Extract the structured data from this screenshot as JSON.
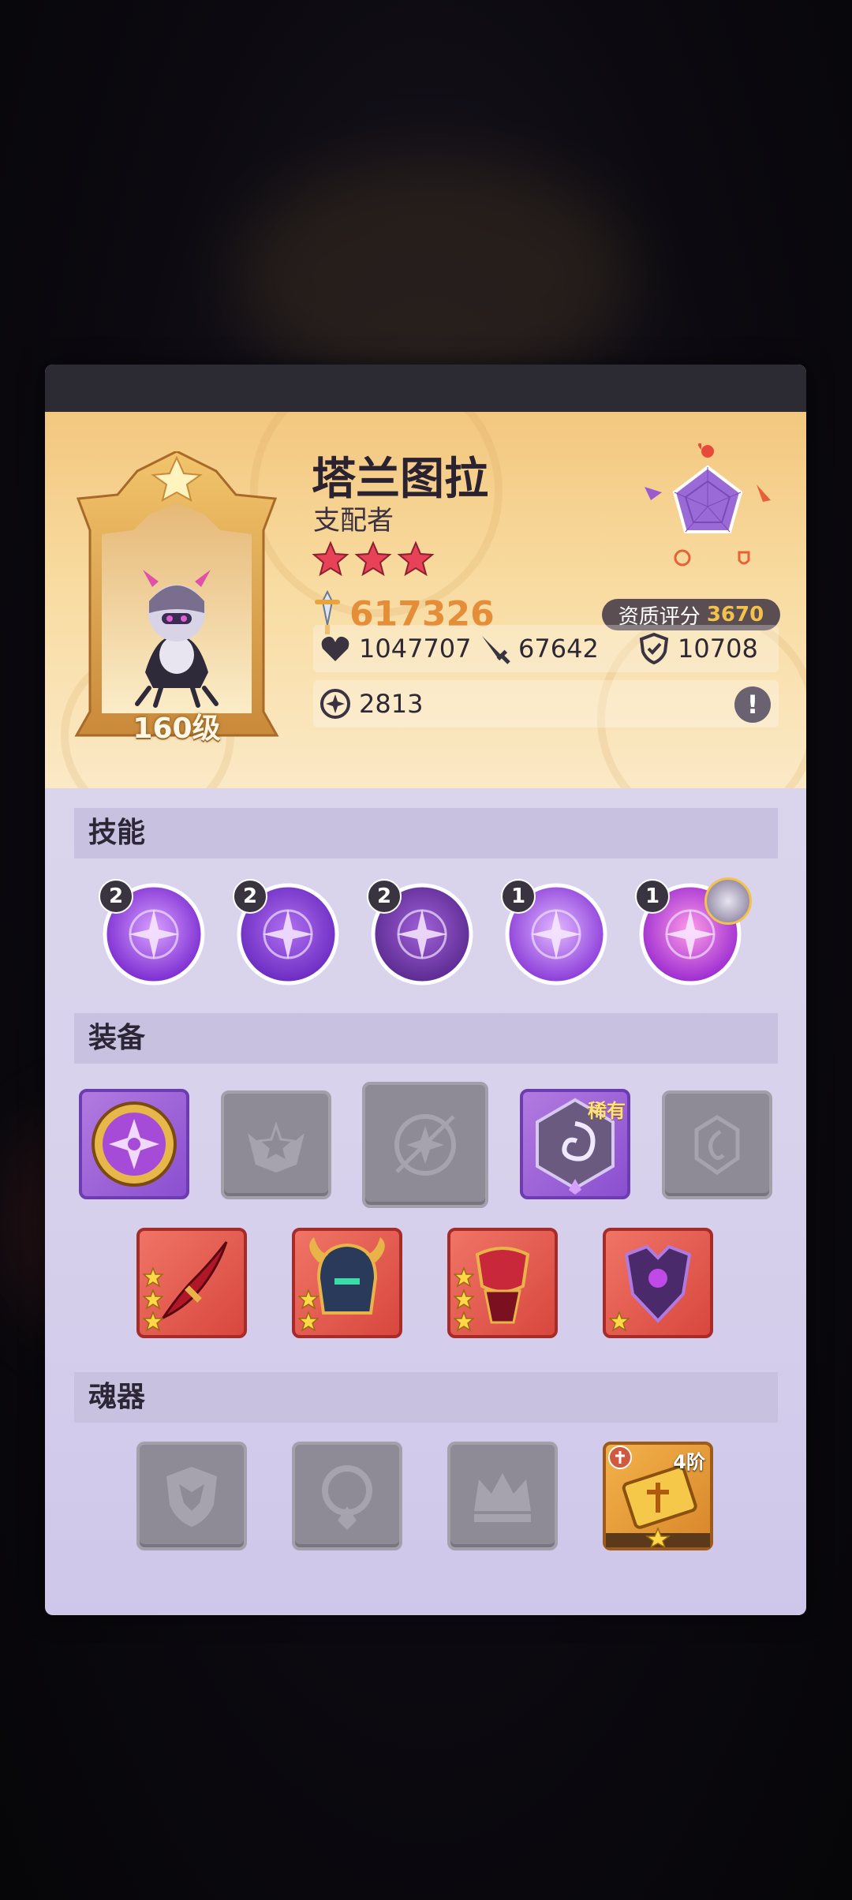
{
  "hero": {
    "name": "塔兰图拉",
    "role": "支配者",
    "level_label": "160级",
    "star_count": 3,
    "power": "617326",
    "quality_label": "资质评分",
    "quality_value": "3670",
    "stats": {
      "hp": "1047707",
      "attack": "67642",
      "defense": "10708",
      "speed": "2813"
    },
    "info_icon": "exclamation-icon"
  },
  "sections": {
    "skills": "技能",
    "equipment": "装备",
    "soul_artifacts": "魂器"
  },
  "skills": [
    {
      "level": "2",
      "icon": "claw-slash-icon"
    },
    {
      "level": "2",
      "icon": "web-drop-icon"
    },
    {
      "level": "2",
      "icon": "shadow-demon-icon"
    },
    {
      "level": "1",
      "icon": "spider-web-icon"
    },
    {
      "level": "1",
      "icon": "star-burst-icon"
    }
  ],
  "equipment": {
    "rare_label": "稀有",
    "rune_slots": [
      {
        "state": "filled",
        "icon": "compass-rune-icon"
      },
      {
        "state": "empty",
        "icon": "wing-star-icon"
      },
      {
        "state": "empty",
        "icon": "orbit-star-icon"
      },
      {
        "state": "filled-rare",
        "icon": "swirl-hex-icon"
      },
      {
        "state": "empty",
        "icon": "crest-icon"
      }
    ],
    "gear_slots": [
      {
        "icon": "dagger-icon",
        "stars": 3
      },
      {
        "icon": "horned-helmet-icon",
        "stars": 2
      },
      {
        "icon": "armor-gauntlet-icon",
        "stars": 3
      },
      {
        "icon": "dark-armor-icon",
        "stars": 1
      }
    ]
  },
  "soul_artifacts": {
    "tier_label": "4阶",
    "slots": [
      {
        "state": "empty",
        "icon": "shield-icon"
      },
      {
        "state": "empty",
        "icon": "drop-ring-icon"
      },
      {
        "state": "empty",
        "icon": "crown-icon"
      },
      {
        "state": "filled",
        "icon": "golden-tome-icon",
        "stars": 1
      }
    ]
  },
  "colors": {
    "header_gold": "#f3c77e",
    "power_orange": "#e58e3a",
    "quality_gold": "#f3c24a",
    "panel_lavender": "#dcd6ee"
  }
}
